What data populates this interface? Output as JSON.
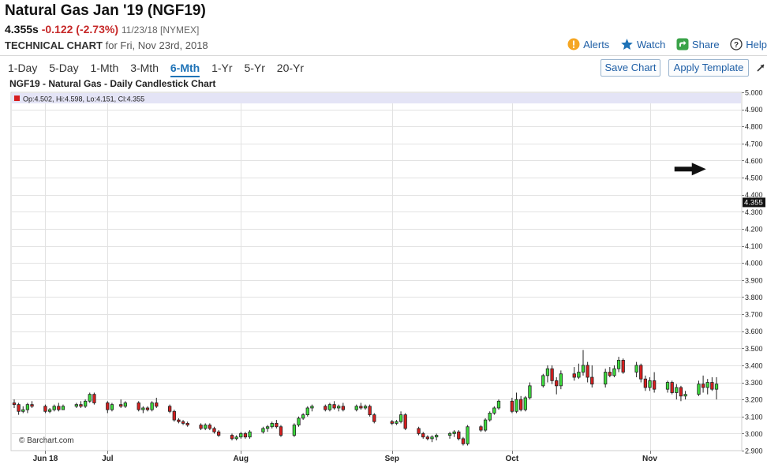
{
  "header": {
    "title": "Natural Gas Jan '19 (NGF19)",
    "last": "4.355s",
    "change": "-0.122 (-2.73%)",
    "stamp": "11/23/18 [NYMEX]",
    "chart_label": "TECHNICAL CHART",
    "chart_date": "for Fri, Nov 23rd, 2018"
  },
  "actions": [
    {
      "label": "Alerts",
      "icon": "alert-icon"
    },
    {
      "label": "Watch",
      "icon": "star-icon"
    },
    {
      "label": "Share",
      "icon": "share-icon"
    },
    {
      "label": "Help",
      "icon": "help-icon"
    }
  ],
  "ranges": [
    "1-Day",
    "5-Day",
    "1-Mth",
    "3-Mth",
    "6-Mth",
    "1-Yr",
    "5-Yr",
    "20-Yr"
  ],
  "active_range": "6-Mth",
  "buttons": {
    "save": "Save Chart",
    "template": "Apply Template"
  },
  "colors": {
    "up": "#3ddc3d",
    "down": "#d61f1f",
    "info_bar": "#e4e4f6",
    "link": "#1f5fa6"
  },
  "chart_data": {
    "type": "candlestick",
    "title": "NGF19 - Natural Gas - Daily Candlestick Chart",
    "info_line": "Op:4.502, Hi:4.598, Lo:4.151, Cl:4.355",
    "last_label": "4.355",
    "copyright": "© Barchart.com",
    "ylim": [
      2.9,
      5.0
    ],
    "y_ticks": [
      "2.900",
      "3.000",
      "3.100",
      "3.200",
      "3.300",
      "3.400",
      "3.500",
      "3.600",
      "3.700",
      "3.800",
      "3.900",
      "4.000",
      "4.100",
      "4.200",
      "4.300",
      "4.400",
      "4.500",
      "4.600",
      "4.700",
      "4.800",
      "4.900",
      "5.000"
    ],
    "x_ticks": [
      {
        "label": "Jun 18",
        "date": "2018-06-18"
      },
      {
        "label": "Jul",
        "date": "2018-07-02"
      },
      {
        "label": "Aug",
        "date": "2018-08-01"
      },
      {
        "label": "Sep",
        "date": "2018-09-04"
      },
      {
        "label": "Oct",
        "date": "2018-10-01"
      },
      {
        "label": "Nov",
        "date": "2018-11-01"
      }
    ],
    "annotations": [
      {
        "type": "arrow",
        "date": "2018-11-14",
        "value": 4.55
      }
    ],
    "candles": [
      {
        "d": "2018-06-11",
        "o": 3.18,
        "h": 3.2,
        "l": 3.15,
        "c": 3.17
      },
      {
        "d": "2018-06-12",
        "o": 3.17,
        "h": 3.18,
        "l": 3.11,
        "c": 3.13
      },
      {
        "d": "2018-06-13",
        "o": 3.13,
        "h": 3.16,
        "l": 3.12,
        "c": 3.14
      },
      {
        "d": "2018-06-14",
        "o": 3.14,
        "h": 3.18,
        "l": 3.12,
        "c": 3.17
      },
      {
        "d": "2018-06-15",
        "o": 3.17,
        "h": 3.19,
        "l": 3.15,
        "c": 3.16
      },
      {
        "d": "2018-06-18",
        "o": 3.16,
        "h": 3.17,
        "l": 3.12,
        "c": 3.13
      },
      {
        "d": "2018-06-19",
        "o": 3.13,
        "h": 3.15,
        "l": 3.12,
        "c": 3.14
      },
      {
        "d": "2018-06-20",
        "o": 3.14,
        "h": 3.17,
        "l": 3.13,
        "c": 3.16
      },
      {
        "d": "2018-06-21",
        "o": 3.16,
        "h": 3.18,
        "l": 3.13,
        "c": 3.14
      },
      {
        "d": "2018-06-22",
        "o": 3.14,
        "h": 3.17,
        "l": 3.14,
        "c": 3.16
      },
      {
        "d": "2018-06-25",
        "o": 3.16,
        "h": 3.18,
        "l": 3.15,
        "c": 3.17
      },
      {
        "d": "2018-06-26",
        "o": 3.17,
        "h": 3.19,
        "l": 3.15,
        "c": 3.16
      },
      {
        "d": "2018-06-27",
        "o": 3.16,
        "h": 3.2,
        "l": 3.15,
        "c": 3.19
      },
      {
        "d": "2018-06-28",
        "o": 3.19,
        "h": 3.24,
        "l": 3.18,
        "c": 3.23
      },
      {
        "d": "2018-06-29",
        "o": 3.23,
        "h": 3.24,
        "l": 3.17,
        "c": 3.18
      },
      {
        "d": "2018-07-02",
        "o": 3.18,
        "h": 3.19,
        "l": 3.12,
        "c": 3.14
      },
      {
        "d": "2018-07-03",
        "o": 3.14,
        "h": 3.18,
        "l": 3.13,
        "c": 3.17
      },
      {
        "d": "2018-07-05",
        "o": 3.17,
        "h": 3.2,
        "l": 3.15,
        "c": 3.16
      },
      {
        "d": "2018-07-06",
        "o": 3.16,
        "h": 3.19,
        "l": 3.15,
        "c": 3.18
      },
      {
        "d": "2018-07-09",
        "o": 3.18,
        "h": 3.19,
        "l": 3.13,
        "c": 3.14
      },
      {
        "d": "2018-07-10",
        "o": 3.14,
        "h": 3.16,
        "l": 3.12,
        "c": 3.15
      },
      {
        "d": "2018-07-11",
        "o": 3.15,
        "h": 3.16,
        "l": 3.13,
        "c": 3.14
      },
      {
        "d": "2018-07-12",
        "o": 3.14,
        "h": 3.19,
        "l": 3.13,
        "c": 3.18
      },
      {
        "d": "2018-07-13",
        "o": 3.18,
        "h": 3.21,
        "l": 3.15,
        "c": 3.16
      },
      {
        "d": "2018-07-16",
        "o": 3.16,
        "h": 3.17,
        "l": 3.12,
        "c": 3.13
      },
      {
        "d": "2018-07-17",
        "o": 3.13,
        "h": 3.14,
        "l": 3.07,
        "c": 3.08
      },
      {
        "d": "2018-07-18",
        "o": 3.08,
        "h": 3.09,
        "l": 3.06,
        "c": 3.07
      },
      {
        "d": "2018-07-19",
        "o": 3.07,
        "h": 3.08,
        "l": 3.05,
        "c": 3.06
      },
      {
        "d": "2018-07-20",
        "o": 3.06,
        "h": 3.07,
        "l": 3.04,
        "c": 3.05
      },
      {
        "d": "2018-07-23",
        "o": 3.05,
        "h": 3.06,
        "l": 3.02,
        "c": 3.03
      },
      {
        "d": "2018-07-24",
        "o": 3.03,
        "h": 3.06,
        "l": 3.02,
        "c": 3.05
      },
      {
        "d": "2018-07-25",
        "o": 3.05,
        "h": 3.06,
        "l": 3.02,
        "c": 3.03
      },
      {
        "d": "2018-07-26",
        "o": 3.03,
        "h": 3.04,
        "l": 3.0,
        "c": 3.01
      },
      {
        "d": "2018-07-27",
        "o": 3.01,
        "h": 3.02,
        "l": 2.98,
        "c": 2.99
      },
      {
        "d": "2018-07-30",
        "o": 2.99,
        "h": 3.0,
        "l": 2.96,
        "c": 2.97
      },
      {
        "d": "2018-07-31",
        "o": 2.97,
        "h": 2.99,
        "l": 2.96,
        "c": 2.98
      },
      {
        "d": "2018-08-01",
        "o": 2.98,
        "h": 3.01,
        "l": 2.97,
        "c": 3.0
      },
      {
        "d": "2018-08-02",
        "o": 3.0,
        "h": 3.01,
        "l": 2.97,
        "c": 2.98
      },
      {
        "d": "2018-08-03",
        "o": 2.98,
        "h": 3.02,
        "l": 2.97,
        "c": 3.01
      },
      {
        "d": "2018-08-06",
        "o": 3.01,
        "h": 3.04,
        "l": 3.0,
        "c": 3.03
      },
      {
        "d": "2018-08-07",
        "o": 3.03,
        "h": 3.05,
        "l": 3.01,
        "c": 3.04
      },
      {
        "d": "2018-08-08",
        "o": 3.04,
        "h": 3.07,
        "l": 3.03,
        "c": 3.06
      },
      {
        "d": "2018-08-09",
        "o": 3.06,
        "h": 3.08,
        "l": 3.03,
        "c": 3.04
      },
      {
        "d": "2018-08-10",
        "o": 3.04,
        "h": 3.05,
        "l": 2.98,
        "c": 2.99
      },
      {
        "d": "2018-08-13",
        "o": 2.99,
        "h": 3.06,
        "l": 2.98,
        "c": 3.05
      },
      {
        "d": "2018-08-14",
        "o": 3.05,
        "h": 3.1,
        "l": 3.04,
        "c": 3.09
      },
      {
        "d": "2018-08-15",
        "o": 3.09,
        "h": 3.12,
        "l": 3.08,
        "c": 3.11
      },
      {
        "d": "2018-08-16",
        "o": 3.11,
        "h": 3.16,
        "l": 3.1,
        "c": 3.15
      },
      {
        "d": "2018-08-17",
        "o": 3.15,
        "h": 3.17,
        "l": 3.13,
        "c": 3.16
      },
      {
        "d": "2018-08-20",
        "o": 3.16,
        "h": 3.17,
        "l": 3.13,
        "c": 3.14
      },
      {
        "d": "2018-08-21",
        "o": 3.14,
        "h": 3.18,
        "l": 3.13,
        "c": 3.17
      },
      {
        "d": "2018-08-22",
        "o": 3.17,
        "h": 3.19,
        "l": 3.14,
        "c": 3.15
      },
      {
        "d": "2018-08-23",
        "o": 3.15,
        "h": 3.17,
        "l": 3.13,
        "c": 3.16
      },
      {
        "d": "2018-08-24",
        "o": 3.16,
        "h": 3.18,
        "l": 3.13,
        "c": 3.14
      },
      {
        "d": "2018-08-27",
        "o": 3.14,
        "h": 3.17,
        "l": 3.13,
        "c": 3.16
      },
      {
        "d": "2018-08-28",
        "o": 3.16,
        "h": 3.18,
        "l": 3.14,
        "c": 3.15
      },
      {
        "d": "2018-08-29",
        "o": 3.15,
        "h": 3.17,
        "l": 3.14,
        "c": 3.16
      },
      {
        "d": "2018-08-30",
        "o": 3.16,
        "h": 3.17,
        "l": 3.1,
        "c": 3.11
      },
      {
        "d": "2018-08-31",
        "o": 3.11,
        "h": 3.12,
        "l": 3.06,
        "c": 3.07
      },
      {
        "d": "2018-09-04",
        "o": 3.07,
        "h": 3.08,
        "l": 3.05,
        "c": 3.06
      },
      {
        "d": "2018-09-05",
        "o": 3.06,
        "h": 3.08,
        "l": 3.05,
        "c": 3.07
      },
      {
        "d": "2018-09-06",
        "o": 3.07,
        "h": 3.13,
        "l": 3.06,
        "c": 3.11
      },
      {
        "d": "2018-09-07",
        "o": 3.11,
        "h": 3.12,
        "l": 3.02,
        "c": 3.03
      },
      {
        "d": "2018-09-10",
        "o": 3.03,
        "h": 3.04,
        "l": 2.99,
        "c": 3.0
      },
      {
        "d": "2018-09-11",
        "o": 3.0,
        "h": 3.01,
        "l": 2.97,
        "c": 2.98
      },
      {
        "d": "2018-09-12",
        "o": 2.98,
        "h": 2.99,
        "l": 2.96,
        "c": 2.97
      },
      {
        "d": "2018-09-13",
        "o": 2.97,
        "h": 2.99,
        "l": 2.95,
        "c": 2.98
      },
      {
        "d": "2018-09-14",
        "o": 2.98,
        "h": 3.0,
        "l": 2.96,
        "c": 2.99
      },
      {
        "d": "2018-09-17",
        "o": 2.99,
        "h": 3.01,
        "l": 2.97,
        "c": 3.0
      },
      {
        "d": "2018-09-18",
        "o": 3.0,
        "h": 3.02,
        "l": 2.98,
        "c": 3.01
      },
      {
        "d": "2018-09-19",
        "o": 3.01,
        "h": 3.02,
        "l": 2.96,
        "c": 2.97
      },
      {
        "d": "2018-09-20",
        "o": 2.97,
        "h": 2.98,
        "l": 2.93,
        "c": 2.94
      },
      {
        "d": "2018-09-21",
        "o": 2.94,
        "h": 3.05,
        "l": 2.93,
        "c": 3.04
      },
      {
        "d": "2018-09-24",
        "o": 3.04,
        "h": 3.05,
        "l": 3.01,
        "c": 3.02
      },
      {
        "d": "2018-09-25",
        "o": 3.02,
        "h": 3.09,
        "l": 3.01,
        "c": 3.08
      },
      {
        "d": "2018-09-26",
        "o": 3.08,
        "h": 3.13,
        "l": 3.07,
        "c": 3.12
      },
      {
        "d": "2018-09-27",
        "o": 3.12,
        "h": 3.16,
        "l": 3.11,
        "c": 3.15
      },
      {
        "d": "2018-09-28",
        "o": 3.15,
        "h": 3.2,
        "l": 3.14,
        "c": 3.19
      },
      {
        "d": "2018-10-01",
        "o": 3.19,
        "h": 3.21,
        "l": 3.12,
        "c": 3.13
      },
      {
        "d": "2018-10-02",
        "o": 3.13,
        "h": 3.24,
        "l": 3.12,
        "c": 3.2
      },
      {
        "d": "2018-10-03",
        "o": 3.2,
        "h": 3.22,
        "l": 3.13,
        "c": 3.14
      },
      {
        "d": "2018-10-04",
        "o": 3.14,
        "h": 3.22,
        "l": 3.13,
        "c": 3.21
      },
      {
        "d": "2018-10-05",
        "o": 3.21,
        "h": 3.3,
        "l": 3.2,
        "c": 3.28
      },
      {
        "d": "2018-10-08",
        "o": 3.28,
        "h": 3.35,
        "l": 3.27,
        "c": 3.34
      },
      {
        "d": "2018-10-09",
        "o": 3.34,
        "h": 3.4,
        "l": 3.3,
        "c": 3.38
      },
      {
        "d": "2018-10-10",
        "o": 3.38,
        "h": 3.4,
        "l": 3.29,
        "c": 3.31
      },
      {
        "d": "2018-10-11",
        "o": 3.31,
        "h": 3.33,
        "l": 3.23,
        "c": 3.28
      },
      {
        "d": "2018-10-12",
        "o": 3.28,
        "h": 3.37,
        "l": 3.26,
        "c": 3.35
      },
      {
        "d": "2018-10-15",
        "o": 3.35,
        "h": 3.39,
        "l": 3.31,
        "c": 3.33
      },
      {
        "d": "2018-10-16",
        "o": 3.33,
        "h": 3.41,
        "l": 3.32,
        "c": 3.36
      },
      {
        "d": "2018-10-17",
        "o": 3.36,
        "h": 3.49,
        "l": 3.34,
        "c": 3.4
      },
      {
        "d": "2018-10-18",
        "o": 3.4,
        "h": 3.42,
        "l": 3.3,
        "c": 3.33
      },
      {
        "d": "2018-10-19",
        "o": 3.33,
        "h": 3.4,
        "l": 3.27,
        "c": 3.29
      },
      {
        "d": "2018-10-22",
        "o": 3.29,
        "h": 3.38,
        "l": 3.27,
        "c": 3.36
      },
      {
        "d": "2018-10-23",
        "o": 3.36,
        "h": 3.39,
        "l": 3.33,
        "c": 3.34
      },
      {
        "d": "2018-10-24",
        "o": 3.34,
        "h": 3.4,
        "l": 3.33,
        "c": 3.38
      },
      {
        "d": "2018-10-25",
        "o": 3.38,
        "h": 3.45,
        "l": 3.36,
        "c": 3.43
      },
      {
        "d": "2018-10-26",
        "o": 3.43,
        "h": 3.44,
        "l": 3.35,
        "c": 3.36
      },
      {
        "d": "2018-10-29",
        "o": 3.36,
        "h": 3.42,
        "l": 3.33,
        "c": 3.4
      },
      {
        "d": "2018-10-30",
        "o": 3.4,
        "h": 3.41,
        "l": 3.3,
        "c": 3.32
      },
      {
        "d": "2018-10-31",
        "o": 3.32,
        "h": 3.34,
        "l": 3.25,
        "c": 3.27
      },
      {
        "d": "2018-11-01",
        "o": 3.27,
        "h": 3.33,
        "l": 3.25,
        "c": 3.31
      },
      {
        "d": "2018-11-02",
        "o": 3.31,
        "h": 3.36,
        "l": 3.24,
        "c": 3.26
      },
      {
        "d": "2018-11-05",
        "o": 3.26,
        "h": 3.31,
        "l": 3.24,
        "c": 3.3
      },
      {
        "d": "2018-11-06",
        "o": 3.3,
        "h": 3.31,
        "l": 3.23,
        "c": 3.24
      },
      {
        "d": "2018-11-07",
        "o": 3.24,
        "h": 3.29,
        "l": 3.2,
        "c": 3.27
      },
      {
        "d": "2018-11-08",
        "o": 3.27,
        "h": 3.28,
        "l": 3.19,
        "c": 3.22
      },
      {
        "d": "2018-11-09",
        "o": 3.22,
        "h": 3.25,
        "l": 3.2,
        "c": 3.23
      },
      {
        "d": "2018-11-12",
        "o": 3.23,
        "h": 3.31,
        "l": 3.22,
        "c": 3.29
      },
      {
        "d": "2018-11-13",
        "o": 3.29,
        "h": 3.34,
        "l": 3.24,
        "c": 3.27
      },
      {
        "d": "2018-11-14",
        "o": 3.27,
        "h": 3.32,
        "l": 3.23,
        "c": 3.3
      },
      {
        "d": "2018-11-15",
        "o": 3.3,
        "h": 3.33,
        "l": 3.25,
        "c": 3.26
      },
      {
        "d": "2018-11-16",
        "o": 3.26,
        "h": 3.33,
        "l": 3.2,
        "c": 3.29
      }
    ]
  }
}
